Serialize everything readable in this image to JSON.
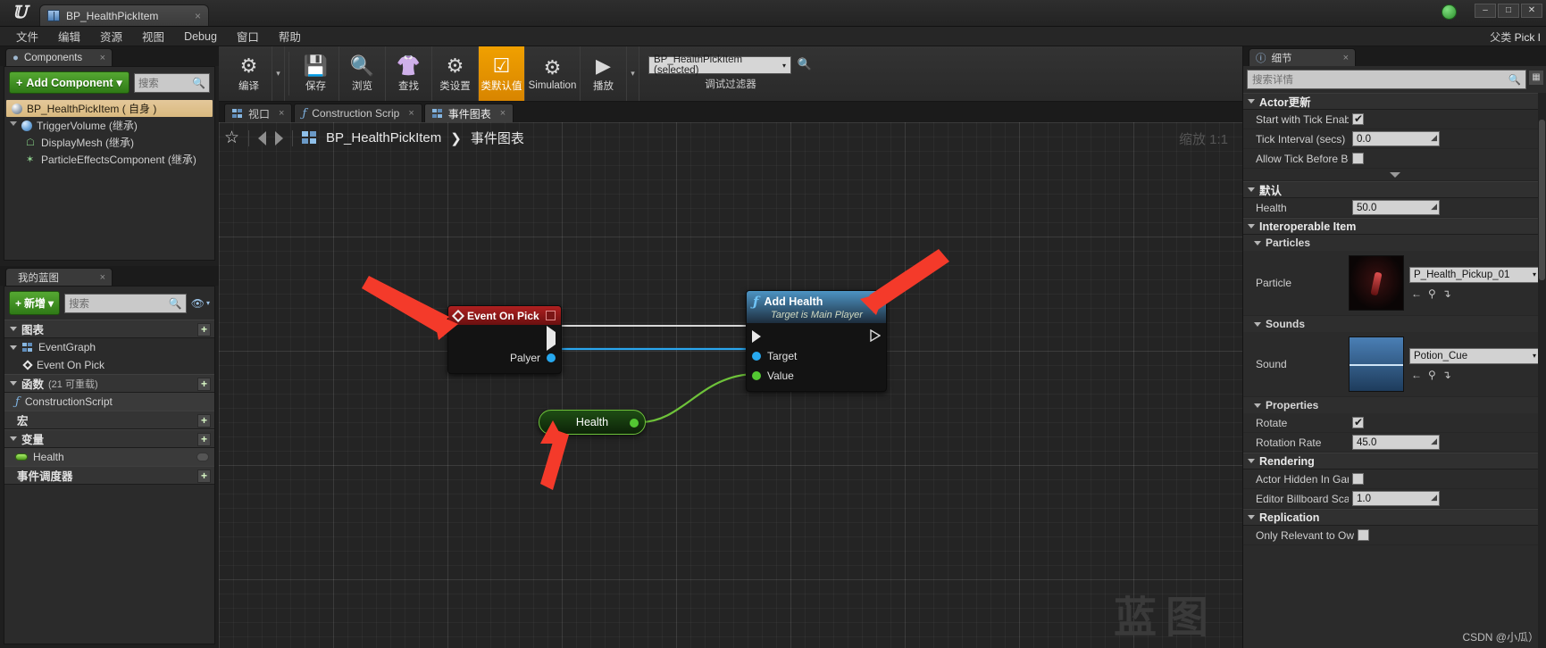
{
  "titlebar": {
    "tab_title": "BP_HealthPickItem",
    "tab_close": "×",
    "logo": "unreal-logo",
    "min": "–",
    "max": "□",
    "close": "✕"
  },
  "menubar": {
    "items": [
      "文件",
      "编辑",
      "资源",
      "视图",
      "Debug",
      "窗口",
      "帮助"
    ],
    "parent_label": "父类",
    "parent_value": "Pick I"
  },
  "components": {
    "tab_label": "Components",
    "tab_close": "×",
    "add_button": "Add Component",
    "add_caret": "▾",
    "search_placeholder": "搜索",
    "tree": [
      {
        "label": "BP_HealthPickItem ( 自身 )",
        "icon": "sphere-icon",
        "indent": 0,
        "selected": true,
        "expander": ""
      },
      {
        "label": "TriggerVolume (继承)",
        "icon": "sphere-blue-icon",
        "indent": 0,
        "selected": false,
        "expander": "open"
      },
      {
        "label": "DisplayMesh (继承)",
        "icon": "mesh-icon",
        "indent": 1,
        "selected": false,
        "expander": ""
      },
      {
        "label": "ParticleEffectsComponent (继承)",
        "icon": "particle-icon",
        "indent": 1,
        "selected": false,
        "expander": ""
      }
    ]
  },
  "myblueprint": {
    "tab_label": "我的蓝图",
    "tab_close": "×",
    "add_button": "新增",
    "add_caret": "▾",
    "search_placeholder": "搜索",
    "eye_icon": "eye-icon",
    "sections": [
      {
        "title": "图表",
        "count": "",
        "plus": "+",
        "rows": [
          {
            "label": "EventGraph",
            "icon": "graph-icon",
            "sub": false,
            "hl": false
          },
          {
            "label": "Event On Pick",
            "icon": "diamond-icon",
            "sub": true,
            "hl": false
          }
        ]
      },
      {
        "title": "函数",
        "count": "(21 可重载)",
        "plus": "+",
        "rows": [
          {
            "label": "ConstructionScript",
            "icon": "function-icon",
            "sub": false,
            "hl": true
          }
        ]
      },
      {
        "title": "宏",
        "count": "",
        "plus": "+",
        "rows": []
      },
      {
        "title": "变量",
        "count": "",
        "plus": "+",
        "rows": [
          {
            "label": "Health",
            "icon": "variable-pill-icon",
            "sub": false,
            "hl": true
          }
        ]
      },
      {
        "title": "事件调度器",
        "count": "",
        "plus": "+",
        "rows": []
      }
    ]
  },
  "toolbar": {
    "buttons": [
      {
        "label": "编译",
        "icon": "compile-icon",
        "active": false,
        "caret": true
      },
      {
        "label": "保存",
        "icon": "save-icon",
        "active": false,
        "caret": false
      },
      {
        "label": "浏览",
        "icon": "browse-icon",
        "active": false,
        "caret": false
      },
      {
        "label": "查找",
        "icon": "find-icon",
        "active": false,
        "caret": false
      },
      {
        "label": "类设置",
        "icon": "class-settings-icon",
        "active": false,
        "caret": false
      },
      {
        "label": "类默认值",
        "icon": "class-defaults-icon",
        "active": true,
        "caret": false
      },
      {
        "label": "Simulation",
        "icon": "simulation-icon",
        "active": false,
        "caret": false
      },
      {
        "label": "播放",
        "icon": "play-icon",
        "active": false,
        "caret": true
      }
    ],
    "debug_filter_label": "调试过滤器",
    "debug_filter_value": "BP_HealthPickItem (selected)",
    "debug_filter_caret": "▾",
    "search_icon": "search-icon"
  },
  "graph": {
    "tabs": [
      {
        "label": "视口",
        "icon": "viewport-icon",
        "active": false,
        "close": "×"
      },
      {
        "label": "Construction Scrip",
        "icon": "function-icon",
        "active": false,
        "close": "×"
      },
      {
        "label": "事件图表",
        "icon": "graph-icon",
        "active": true,
        "close": "×"
      }
    ],
    "breadcrumb_star": "☆",
    "breadcrumb_root": "BP_HealthPickItem",
    "breadcrumb_sep": "❯",
    "breadcrumb_leaf": "事件图表",
    "zoom_label": "缩放 1:1",
    "watermark": "蓝图",
    "nodes": {
      "event": {
        "title": "Event On Pick",
        "icon": "event-diamond-icon",
        "delegate_icon": "delegate-pin-icon",
        "exec_out": "",
        "output_pin": "Palyer"
      },
      "function": {
        "title": "Add Health",
        "subtitle": "Target is Main Player",
        "icon": "function-f-icon",
        "exec_in": "",
        "exec_out": "",
        "pins": [
          "Target",
          "Value"
        ]
      },
      "variable": {
        "label": "Health",
        "pin": "variable-out-pin"
      }
    }
  },
  "details": {
    "tab_label": "细节",
    "tab_close": "×",
    "tab_icon": "details-magnifier-icon",
    "search_placeholder": "搜索详情",
    "grid_icon": "grid-view-icon",
    "caret_icon": "▾",
    "categories": [
      {
        "title": "Actor更新",
        "type": "category",
        "rows": [
          {
            "label": "Start with Tick Enabled",
            "kind": "checkbox",
            "value": true
          },
          {
            "label": "Tick Interval (secs)",
            "kind": "number",
            "value": "0.0"
          },
          {
            "label": "Allow Tick Before Begin",
            "kind": "checkbox",
            "value": false
          }
        ],
        "expander": true
      },
      {
        "title": "默认",
        "type": "category",
        "rows": [
          {
            "label": "Health",
            "kind": "number",
            "value": "50.0"
          }
        ],
        "expander": false
      },
      {
        "title": "Interoperable Item",
        "type": "category",
        "rows": [],
        "expander": false
      }
    ],
    "particles": {
      "title": "Particles",
      "label": "Particle",
      "asset_value": "P_Health_Pickup_01",
      "thumb": "particle-thumbnail",
      "caret": "▾",
      "btns": [
        "←",
        "⚲",
        "↴"
      ]
    },
    "sounds": {
      "title": "Sounds",
      "label": "Sound",
      "asset_value": "Potion_Cue",
      "thumb": "sound-waveform-thumbnail",
      "caret": "▾",
      "btns": [
        "←",
        "⚲",
        "↴"
      ]
    },
    "properties": {
      "title": "Properties",
      "rows": [
        {
          "label": "Rotate",
          "kind": "checkbox",
          "value": true
        },
        {
          "label": "Rotation Rate",
          "kind": "number",
          "value": "45.0"
        }
      ]
    },
    "rendering": {
      "title": "Rendering",
      "rows": [
        {
          "label": "Actor Hidden In Game",
          "kind": "checkbox",
          "value": false
        },
        {
          "label": "Editor Billboard Scale",
          "kind": "number",
          "value": "1.0"
        }
      ]
    },
    "replication": {
      "title": "Replication",
      "rows": [
        {
          "label": "Only Relevant to Owner",
          "kind": "checkbox",
          "value": false
        }
      ]
    },
    "watermark": "CSDN @小瓜）"
  }
}
